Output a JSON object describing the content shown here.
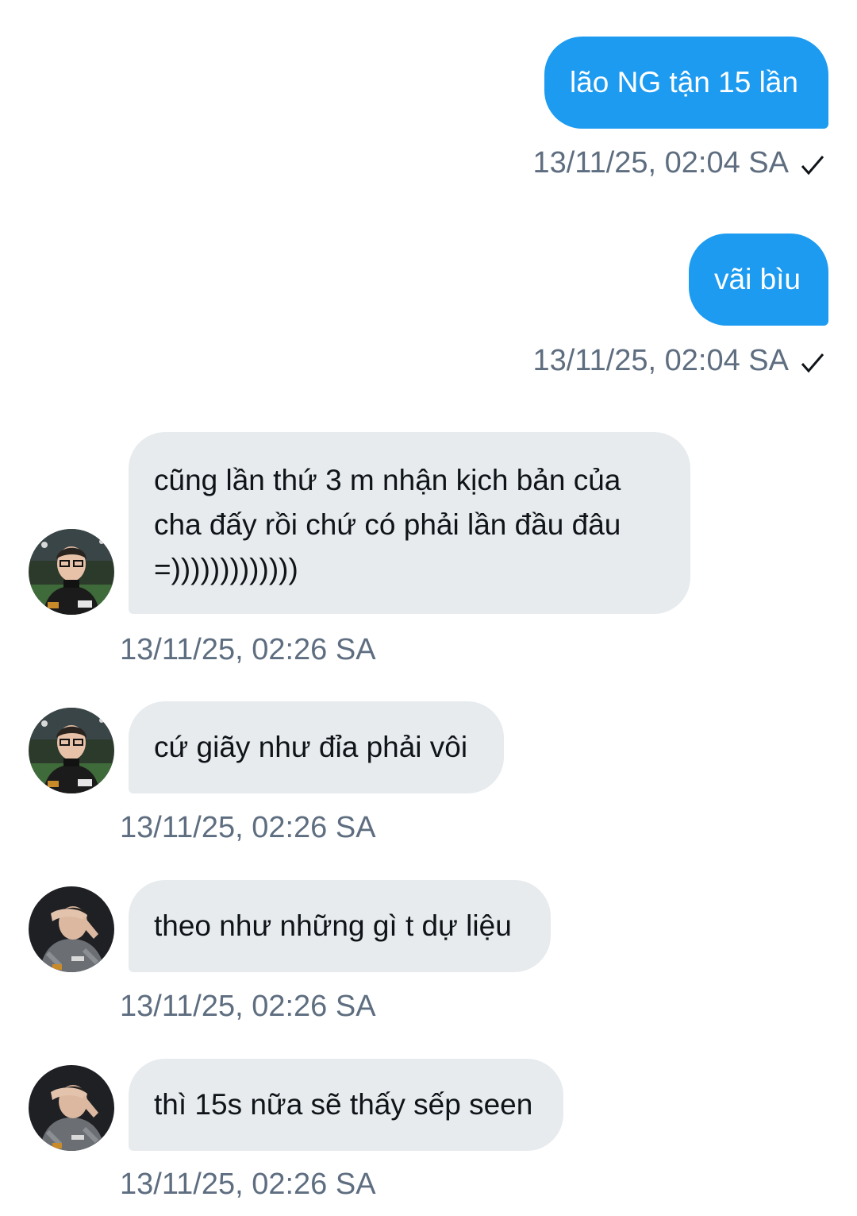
{
  "messages": [
    {
      "direction": "out",
      "text": "lão NG tận 15 lần",
      "timestamp": "13/11/25, 02:04 SA",
      "status_icon": "check-icon"
    },
    {
      "direction": "out",
      "text": "vãi bìu",
      "timestamp": "13/11/25, 02:04 SA",
      "status_icon": "check-icon"
    },
    {
      "direction": "in",
      "text": "cũng lần thứ 3 m nhận kịch bản của cha đấy rồi chứ có phải lần đầu đâu =)))))))))))))",
      "timestamp": "13/11/25, 02:26 SA",
      "avatar": "avatar-glasses"
    },
    {
      "direction": "in",
      "text": "cứ giãy như đỉa phải vôi",
      "timestamp": "13/11/25, 02:26 SA",
      "avatar": "avatar-glasses"
    },
    {
      "direction": "in",
      "text": "theo như những gì t dự liệu",
      "timestamp": "13/11/25, 02:26 SA",
      "avatar": "avatar-hand"
    },
    {
      "direction": "in",
      "text": "thì 15s nữa sẽ thấy sếp seen",
      "timestamp": "13/11/25, 02:26 SA",
      "avatar": "avatar-hand"
    }
  ],
  "colors": {
    "outgoing_bubble": "#1d9bf0",
    "incoming_bubble": "#e7ebee",
    "timestamp": "#5e6e80"
  }
}
